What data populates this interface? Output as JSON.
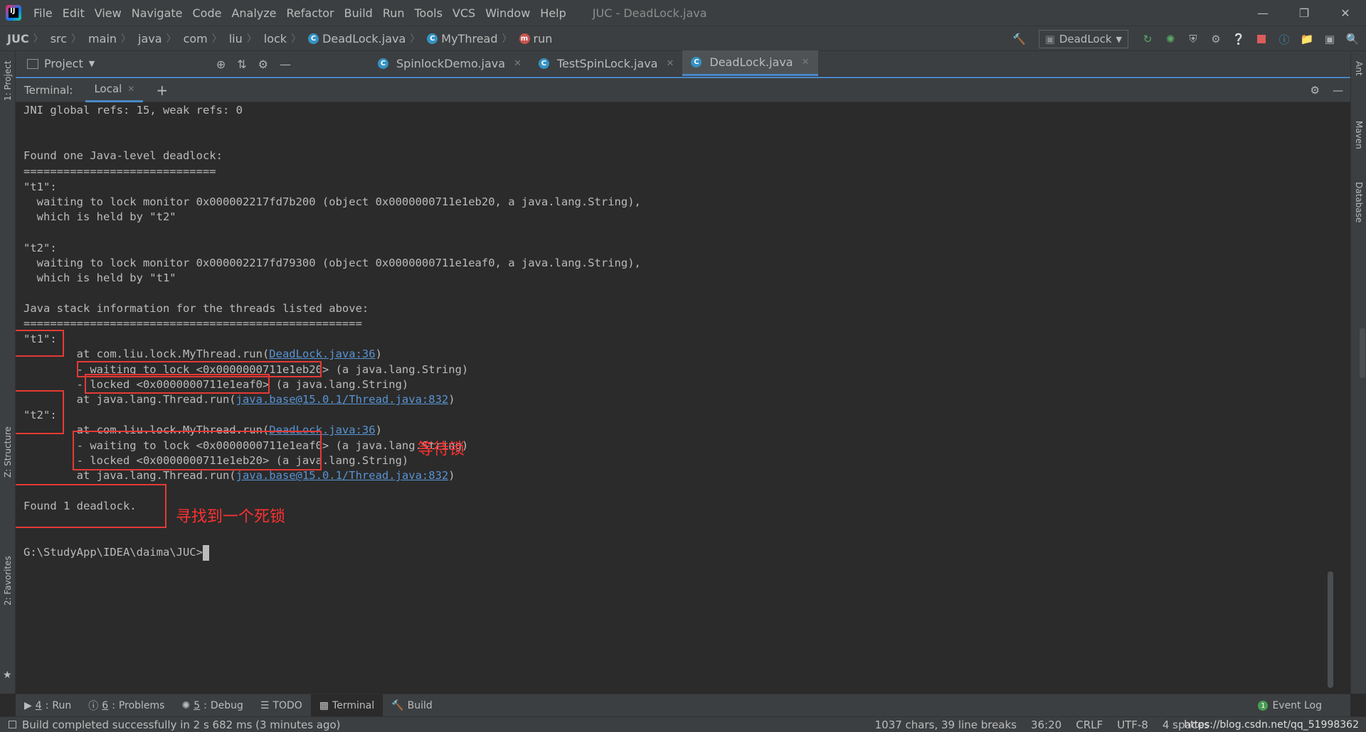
{
  "window": {
    "title": "JUC - DeadLock.java"
  },
  "menu": [
    "File",
    "Edit",
    "View",
    "Navigate",
    "Code",
    "Analyze",
    "Refactor",
    "Build",
    "Run",
    "Tools",
    "VCS",
    "Window",
    "Help"
  ],
  "breadcrumb": [
    "JUC",
    "src",
    "main",
    "java",
    "com",
    "liu",
    "lock",
    "DeadLock.java",
    "MyThread",
    "run"
  ],
  "run_config": "DeadLock",
  "project_panel": {
    "label": "Project"
  },
  "editor_tabs": [
    "SpinlockDemo.java",
    "TestSpinLock.java",
    "DeadLock.java"
  ],
  "terminal": {
    "label": "Terminal:",
    "tab": "Local",
    "lines": [
      "JNI global refs: 15, weak refs: 0",
      "Found one Java-level deadlock:",
      "=============================",
      "\"t1\":",
      "  waiting to lock monitor 0x000002217fd7b200 (object 0x0000000711e1eb20, a java.lang.String),",
      "  which is held by \"t2\"",
      "\"t2\":",
      "  waiting to lock monitor 0x000002217fd79300 (object 0x0000000711e1eaf0, a java.lang.String),",
      "  which is held by \"t1\"",
      "Java stack information for the threads listed above:",
      "===================================================",
      "\"t1\":",
      "        at com.liu.lock.MyThread.run(",
      "DeadLock.java:36",
      ")",
      "        - waiting to lock <0x0000000711e1eb20> (a java.lang.String)",
      "        - locked <0x0000000711e1eaf0> (a java.lang.String)",
      "        at java.lang.Thread.run(",
      "java.base@15.0.1/Thread.java:832",
      ")",
      "\"t2\":",
      "        at com.liu.lock.MyThread.run(",
      "DeadLock.java:36",
      ")",
      "        - waiting to lock <0x0000000711e1eaf0> (a java.lang.String)",
      "        - locked <0x0000000711e1eb20> (a java.lang.String)",
      "        at java.lang.Thread.run(",
      "java.base@15.0.1/Thread.java:832",
      ")",
      "Found 1 deadlock.",
      "G:\\StudyApp\\IDEA\\daima\\JUC>"
    ]
  },
  "annotations": {
    "waiting_lock": "等待锁",
    "found_deadlock": "寻找到一个死锁"
  },
  "side_tabs": {
    "left": [
      "1: Project",
      "Z: Structure",
      "2: Favorites"
    ],
    "right": [
      "Ant",
      "Maven",
      "Database"
    ]
  },
  "tool_windows": [
    {
      "num": "4",
      "label": "Run"
    },
    {
      "num": "6",
      "label": "Problems"
    },
    {
      "num": "5",
      "label": "Debug"
    },
    {
      "num": "",
      "label": "TODO"
    },
    {
      "num": "",
      "label": "Terminal"
    },
    {
      "num": "",
      "label": "Build"
    }
  ],
  "event_log": {
    "label": "Event Log",
    "count": "1"
  },
  "status": {
    "message": "Build completed successfully in 2 s 682 ms (3 minutes ago)",
    "chars": "1037 chars, 39 line breaks",
    "position": "36:20",
    "line_sep": "CRLF",
    "encoding": "UTF-8",
    "indent": "4 spaces",
    "watermark": "https://blog.csdn.net/qq_51998362"
  }
}
